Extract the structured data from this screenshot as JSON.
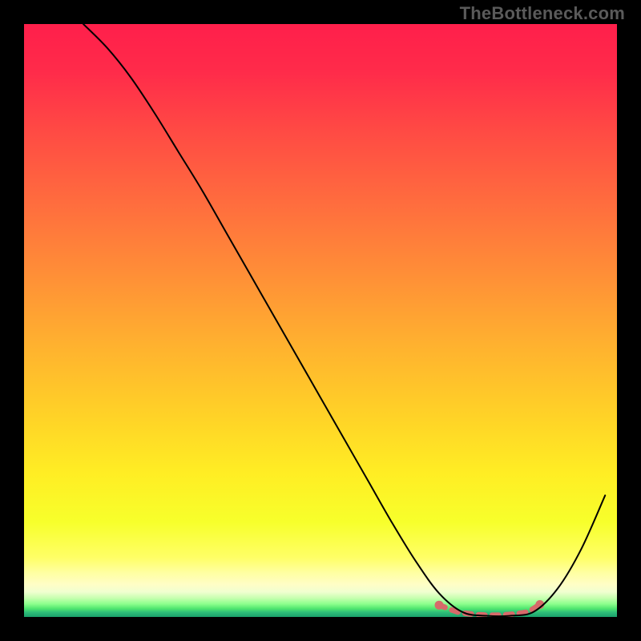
{
  "watermark": "TheBottleneck.com",
  "chart_data": {
    "type": "line",
    "title": "",
    "xlabel": "",
    "ylabel": "",
    "xlim": [
      0,
      100
    ],
    "ylim": [
      0,
      100
    ],
    "grid": false,
    "legend": false,
    "series": [
      {
        "name": "curve",
        "x": [
          10,
          14,
          18,
          22,
          26,
          30,
          34,
          38,
          42,
          46,
          50,
          54,
          58,
          62,
          66,
          70,
          74,
          78,
          82,
          86,
          90,
          94,
          98
        ],
        "y": [
          100,
          96,
          91,
          85,
          78.5,
          72,
          65,
          58,
          51,
          44,
          37,
          30,
          23,
          16,
          9.5,
          4,
          0.8,
          0.2,
          0.2,
          0.9,
          4.8,
          11.5,
          20.5
        ],
        "color": "#000000"
      },
      {
        "name": "trough-marker",
        "x": [
          70,
          73,
          75,
          77,
          79,
          81,
          83,
          85,
          87
        ],
        "y": [
          2.0,
          0.9,
          0.55,
          0.35,
          0.28,
          0.35,
          0.55,
          0.9,
          2.1
        ],
        "color": "#d66a6a"
      }
    ],
    "background_gradient": {
      "stops": [
        {
          "offset": 0.0,
          "color": "#ff1f4b"
        },
        {
          "offset": 0.08,
          "color": "#ff2b4a"
        },
        {
          "offset": 0.18,
          "color": "#ff4a44"
        },
        {
          "offset": 0.3,
          "color": "#ff6c3e"
        },
        {
          "offset": 0.42,
          "color": "#ff8e37"
        },
        {
          "offset": 0.54,
          "color": "#ffb12f"
        },
        {
          "offset": 0.66,
          "color": "#ffd227"
        },
        {
          "offset": 0.76,
          "color": "#ffee24"
        },
        {
          "offset": 0.84,
          "color": "#f7ff2b"
        },
        {
          "offset": 0.9,
          "color": "#ffff66"
        },
        {
          "offset": 0.925,
          "color": "#ffffa1"
        },
        {
          "offset": 0.945,
          "color": "#fffec6"
        },
        {
          "offset": 0.958,
          "color": "#f0ffd0"
        },
        {
          "offset": 0.968,
          "color": "#c7ffb0"
        },
        {
          "offset": 0.978,
          "color": "#8dff8d"
        },
        {
          "offset": 0.986,
          "color": "#4fe66f"
        },
        {
          "offset": 0.992,
          "color": "#2fbf79"
        },
        {
          "offset": 1.0,
          "color": "#1aa06b"
        }
      ]
    }
  }
}
